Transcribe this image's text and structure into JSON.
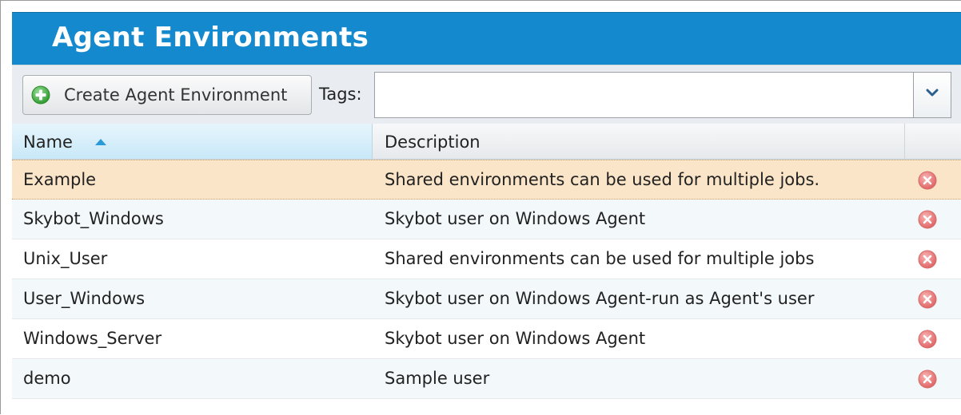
{
  "panel": {
    "title": "Agent Environments"
  },
  "toolbar": {
    "create_button_label": "Create Agent Environment",
    "create_button_icon": "plus-circle-icon",
    "tags_label": "Tags:",
    "tags_value": "",
    "tags_dropdown_icon": "chevron-down-icon"
  },
  "grid": {
    "columns": [
      {
        "label": "Name",
        "sort": "ascending"
      },
      {
        "label": "Description"
      },
      {
        "label": ""
      }
    ],
    "rows": [
      {
        "name": "Example",
        "description": "Shared environments can be used for multiple jobs.",
        "selected": true
      },
      {
        "name": "Skybot_Windows",
        "description": "Skybot user on Windows Agent"
      },
      {
        "name": "Unix_User",
        "description": "Shared environments can be used for multiple jobs"
      },
      {
        "name": "User_Windows",
        "description": "Skybot user on Windows Agent-run as Agent's user"
      },
      {
        "name": "Windows_Server",
        "description": "Skybot user on Windows Agent"
      },
      {
        "name": "demo",
        "description": "Sample user"
      }
    ],
    "row_action_icon": "delete-icon"
  },
  "colors": {
    "title_bar": "#1489cd",
    "selected_row": "#fbe5c8",
    "delete_icon": "#e86a6a",
    "create_icon": "#4cb34c"
  }
}
